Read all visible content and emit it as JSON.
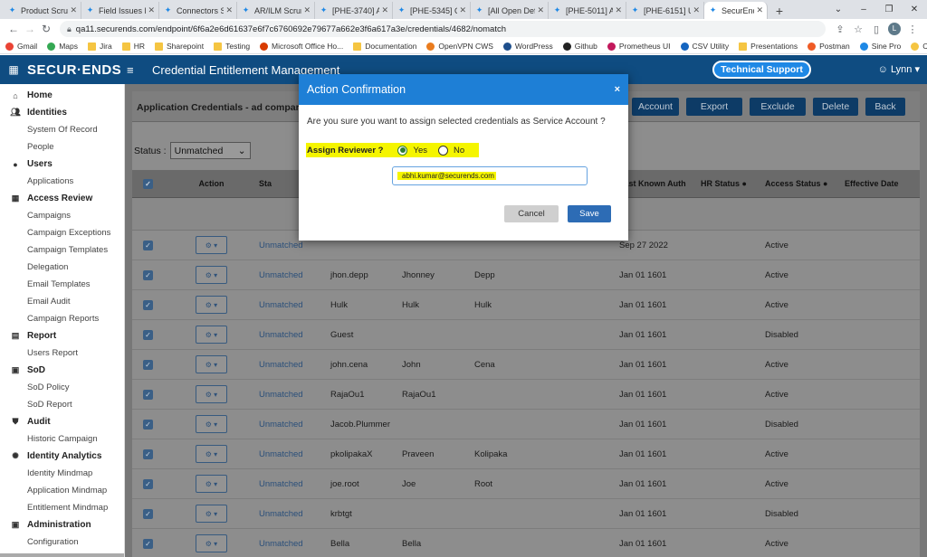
{
  "browser": {
    "tabs": [
      {
        "label": "Product Scrum",
        "color": "#1e88e5"
      },
      {
        "label": "Field Issues Ka",
        "color": "#1e88e5"
      },
      {
        "label": "Connectors Sc",
        "color": "#1e88e5"
      },
      {
        "label": "AR/ILM Scrum",
        "color": "#1e88e5"
      },
      {
        "label": "[PHE-3740] Ac",
        "color": "#1e88e5"
      },
      {
        "label": "[PHE-5345] C",
        "color": "#1e88e5"
      },
      {
        "label": "[All Open Defe",
        "color": "#1e88e5"
      },
      {
        "label": "[PHE-5011] A",
        "color": "#1e88e5"
      },
      {
        "label": "[PHE-6151] U",
        "color": "#1e88e5"
      },
      {
        "label": "SecurEnds",
        "color": "#1e88e5"
      }
    ],
    "new_tab": "+",
    "url": "qa11.securends.com/endpoint/6f6a2e6d61637e6f7c6760692e79677a662e3f6a617a3e/credentials/4682/nomatch",
    "avatar_letter": "L",
    "bookmarks": [
      {
        "label": "Gmail",
        "icon": "gmail-icon",
        "color": "#ea4335"
      },
      {
        "label": "Maps",
        "icon": "maps-icon",
        "color": "#34a853"
      },
      {
        "label": "Jira",
        "icon": "folder-icon",
        "color": "#f5c542"
      },
      {
        "label": "HR",
        "icon": "folder-icon",
        "color": "#f5c542"
      },
      {
        "label": "Sharepoint",
        "icon": "folder-icon",
        "color": "#f5c542"
      },
      {
        "label": "Testing",
        "icon": "folder-icon",
        "color": "#f5c542"
      },
      {
        "label": "Microsoft Office Ho...",
        "icon": "office-icon",
        "color": "#d83b01"
      },
      {
        "label": "Documentation",
        "icon": "folder-icon",
        "color": "#f5c542"
      },
      {
        "label": "OpenVPN CWS",
        "icon": "vpn-icon",
        "color": "#ea7c1e"
      },
      {
        "label": "WordPress",
        "icon": "wordpress-icon",
        "color": "#1e4f8c"
      },
      {
        "label": "Github",
        "icon": "github-icon",
        "color": "#222222"
      },
      {
        "label": "Prometheus UI",
        "icon": "prometheus-icon",
        "color": "#c2185b"
      },
      {
        "label": "CSV Utility",
        "icon": "csv-icon",
        "color": "#1565c0"
      },
      {
        "label": "Presentations",
        "icon": "folder-icon",
        "color": "#f5c542"
      },
      {
        "label": "Postman",
        "icon": "postman-icon",
        "color": "#ef5b25"
      },
      {
        "label": "Sine Pro",
        "icon": "sine-icon",
        "color": "#1e88e5"
      },
      {
        "label": "Concur",
        "icon": "concur-icon",
        "color": "#f5c542"
      }
    ]
  },
  "header": {
    "logo": "SECUR·ENDS",
    "title": "Credential Entitlement Management",
    "support": "Technical Support",
    "user": "Lynn"
  },
  "sidebar": [
    {
      "label": "Home",
      "icon": "home-icon",
      "type": "section"
    },
    {
      "label": "Identities",
      "icon": "users-icon",
      "type": "section"
    },
    {
      "label": "System Of Record",
      "type": "sub"
    },
    {
      "label": "People",
      "type": "sub"
    },
    {
      "label": "Users",
      "icon": "user-icon",
      "type": "section"
    },
    {
      "label": "Applications",
      "type": "sub"
    },
    {
      "label": "Access Review",
      "icon": "grid-icon",
      "type": "section"
    },
    {
      "label": "Campaigns",
      "type": "sub"
    },
    {
      "label": "Campaign Exceptions",
      "type": "sub"
    },
    {
      "label": "Campaign Templates",
      "type": "sub"
    },
    {
      "label": "Delegation",
      "type": "sub"
    },
    {
      "label": "Email Templates",
      "type": "sub"
    },
    {
      "label": "Email Audit",
      "type": "sub"
    },
    {
      "label": "Campaign Reports",
      "type": "sub"
    },
    {
      "label": "Report",
      "icon": "report-icon",
      "type": "section"
    },
    {
      "label": "Users Report",
      "type": "sub"
    },
    {
      "label": "SoD",
      "icon": "sod-icon",
      "type": "section"
    },
    {
      "label": "SoD Policy",
      "type": "sub"
    },
    {
      "label": "SoD Report",
      "type": "sub"
    },
    {
      "label": "Audit",
      "icon": "shield-icon",
      "type": "section"
    },
    {
      "label": "Historic Campaign",
      "type": "sub"
    },
    {
      "label": "Identity Analytics",
      "icon": "analytics-icon",
      "type": "section"
    },
    {
      "label": "Identity Mindmap",
      "type": "sub"
    },
    {
      "label": "Application Mindmap",
      "type": "sub"
    },
    {
      "label": "Entitlement Mindmap",
      "type": "sub"
    },
    {
      "label": "Administration",
      "icon": "admin-icon",
      "type": "section"
    },
    {
      "label": "Configuration",
      "type": "sub"
    }
  ],
  "card": {
    "title": "Application Credentials - ad comparing",
    "buttons": [
      "Account",
      "Export",
      "Exclude",
      "Delete",
      "Back"
    ]
  },
  "status": {
    "label": "Status :",
    "selected": "Unmatched"
  },
  "table": {
    "columns": [
      "",
      "Action",
      "Sta",
      "",
      "",
      "",
      "Last Known Auth",
      "HR Status",
      "Access Status",
      "Effective Date"
    ],
    "rows": [
      {
        "status": "Unmatched",
        "username": "",
        "first": "",
        "last": "",
        "auth": "Sep 27 2022",
        "access": "Active"
      },
      {
        "status": "Unmatched",
        "username": "jhon.depp",
        "first": "Jhonney",
        "last": "Depp",
        "auth": "Jan 01 1601",
        "access": "Active"
      },
      {
        "status": "Unmatched",
        "username": "Hulk",
        "first": "Hulk",
        "last": "Hulk",
        "auth": "Jan 01 1601",
        "access": "Active"
      },
      {
        "status": "Unmatched",
        "username": "Guest",
        "first": "",
        "last": "",
        "auth": "Jan 01 1601",
        "access": "Disabled"
      },
      {
        "status": "Unmatched",
        "username": "john.cena",
        "first": "John",
        "last": "Cena",
        "auth": "Jan 01 1601",
        "access": "Active"
      },
      {
        "status": "Unmatched",
        "username": "RajaOu1",
        "first": "RajaOu1",
        "last": "",
        "auth": "Jan 01 1601",
        "access": "Active"
      },
      {
        "status": "Unmatched",
        "username": "Jacob.Plummer",
        "first": "",
        "last": "",
        "auth": "Jan 01 1601",
        "access": "Disabled"
      },
      {
        "status": "Unmatched",
        "username": "pkolipakaX",
        "first": "Praveen",
        "last": "Kolipaka",
        "auth": "Jan 01 1601",
        "access": "Active"
      },
      {
        "status": "Unmatched",
        "username": "joe.root",
        "first": "Joe",
        "last": "Root",
        "auth": "Jan 01 1601",
        "access": "Active"
      },
      {
        "status": "Unmatched",
        "username": "krbtgt",
        "first": "",
        "last": "",
        "auth": "Jan 01 1601",
        "access": "Disabled"
      },
      {
        "status": "Unmatched",
        "username": "Bella",
        "first": "Bella",
        "last": "",
        "auth": "Jan 01 1601",
        "access": "Active"
      }
    ]
  },
  "modal": {
    "title": "Action Confirmation",
    "close": "×",
    "question": "Are you sure you want to assign selected credentials as Service Account ?",
    "reviewer_label": "Assign Reviewer ?",
    "yes": "Yes",
    "no": "No",
    "email": "abhi.kumar@securends.com",
    "cancel": "Cancel",
    "save": "Save"
  }
}
